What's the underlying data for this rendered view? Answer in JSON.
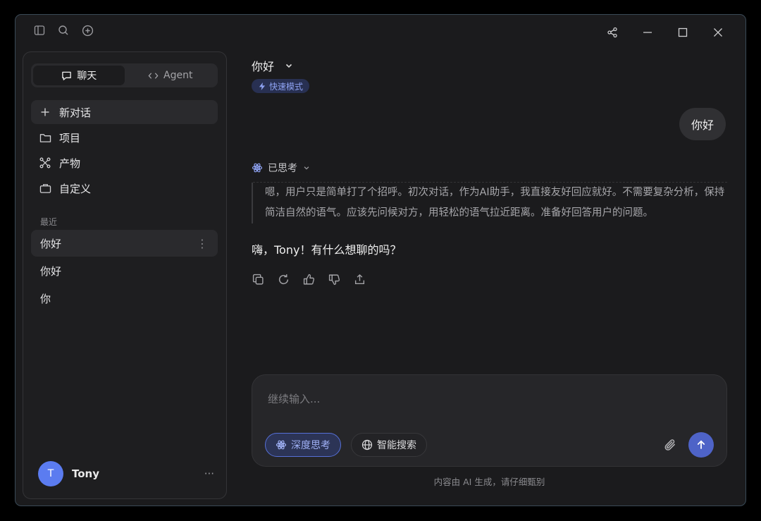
{
  "titlebar": {
    "left_icons": [
      "sidebar-toggle-icon",
      "search-icon",
      "new-chat-icon"
    ],
    "right_icons": [
      "share-icon",
      "minimize-icon",
      "maximize-icon",
      "close-icon"
    ]
  },
  "sidebar": {
    "tabs": [
      {
        "label": "聊天",
        "icon": "chat-bubble-icon",
        "active": true
      },
      {
        "label": "Agent",
        "icon": "code-brackets-icon",
        "active": false
      }
    ],
    "nav": [
      {
        "label": "新对话",
        "icon": "plus-icon"
      },
      {
        "label": "项目",
        "icon": "folder-icon"
      },
      {
        "label": "产物",
        "icon": "nodes-icon"
      },
      {
        "label": "自定义",
        "icon": "briefcase-icon"
      }
    ],
    "recent_label": "最近",
    "recent": [
      {
        "label": "你好",
        "active": true
      },
      {
        "label": "你好",
        "active": false
      },
      {
        "label": "你",
        "active": false
      }
    ],
    "user": {
      "initial": "T",
      "name": "Tony",
      "more": "···"
    }
  },
  "main": {
    "title": "你好",
    "mode_badge": "快速模式",
    "user_message": "你好",
    "thinking": {
      "label": "已思考",
      "text": "嗯，用户只是简单打了个招呼。初次对话，作为AI助手，我直接友好回应就好。不需要复杂分析，保持简洁自然的语气。应该先问候对方，用轻松的语气拉近距离。准备好回答用户的问题。"
    },
    "answer": "嗨，Tony！有什么想聊的吗？",
    "actions": [
      "copy-icon",
      "regenerate-icon",
      "thumbs-up-icon",
      "thumbs-down-icon",
      "share-icon"
    ]
  },
  "composer": {
    "placeholder": "继续输入...",
    "deep_think": "深度思考",
    "smart_search": "智能搜索"
  },
  "disclaimer": "内容由 AI 生成，请仔细甄别",
  "colors": {
    "accent": "#5670d8",
    "send_button": "#4e63c7",
    "avatar": "#5b7cf0",
    "background": "#1b1b1d"
  }
}
